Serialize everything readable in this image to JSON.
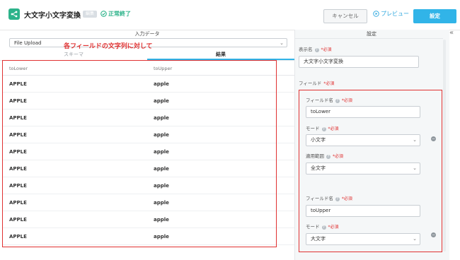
{
  "header": {
    "title": "大文字小文字変換",
    "edit_badge": "編集",
    "status": "正常終了",
    "cancel_label": "キャンセル",
    "preview_label": "プレビュー",
    "settings_label": "設定",
    "accent_color": "#31b4e8",
    "status_color": "#2db38a"
  },
  "left_pane": {
    "title": "入力データ",
    "source_value": "File Upload",
    "tabs": [
      {
        "label": "スキーマ",
        "active": false
      },
      {
        "label": "結果",
        "active": true
      }
    ],
    "annotation": "各フィールドの文字列に対して",
    "table": {
      "columns": [
        "toLower",
        "toUpper"
      ],
      "rows": [
        [
          "APPLE",
          "apple"
        ],
        [
          "APPLE",
          "apple"
        ],
        [
          "APPLE",
          "apple"
        ],
        [
          "APPLE",
          "apple"
        ],
        [
          "APPLE",
          "apple"
        ],
        [
          "APPLE",
          "apple"
        ],
        [
          "APPLE",
          "apple"
        ],
        [
          "APPLE",
          "apple"
        ],
        [
          "APPLE",
          "apple"
        ],
        [
          "APPLE",
          "apple"
        ]
      ]
    }
  },
  "right_pane": {
    "title": "設定",
    "display_name_label": "表示名",
    "required_label": "*必須",
    "display_name_value": "大文字小文字変換",
    "fields_label": "フィールド",
    "field_name_label": "フィールド名",
    "mode_label": "モード",
    "scope_label": "適用範囲",
    "field_cards": [
      {
        "name": "toLower",
        "mode": "小文字",
        "scope": "全文字"
      },
      {
        "name": "toUpper",
        "mode": "大文字"
      }
    ]
  }
}
